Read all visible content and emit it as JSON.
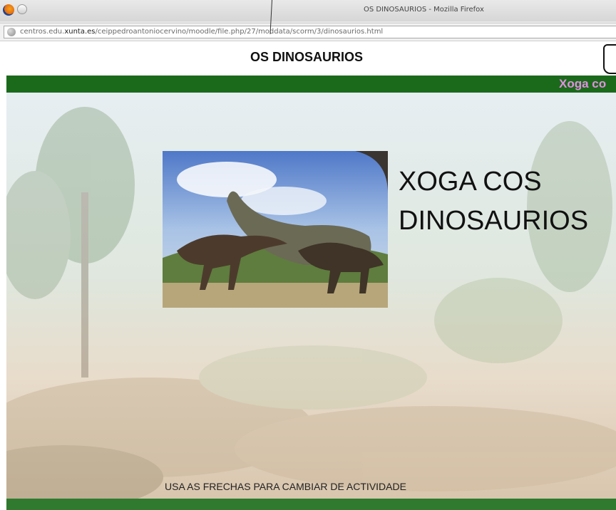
{
  "window": {
    "title": "OS DINOSAURIOS - Mozilla Firefox"
  },
  "urlbar": {
    "url_prefix": "centros.edu.",
    "url_domain": "xunta.es",
    "url_path": "/ceippedroantoniocervino/moodle/file.php/27/moddata/scorm/3/dinosaurios.html"
  },
  "page": {
    "heading": "OS DINOSAURIOS",
    "marquee_text": "Xoga co",
    "main_title_line1": "XOGA COS",
    "main_title_line2": "DINOSAURIOS",
    "footer_instruction": "USA AS FRECHAS PARA CAMBIAR DE ACTIVIDADE"
  },
  "colors": {
    "green_bar": "#1b6a1b",
    "marquee_text": "#e48ee4"
  }
}
